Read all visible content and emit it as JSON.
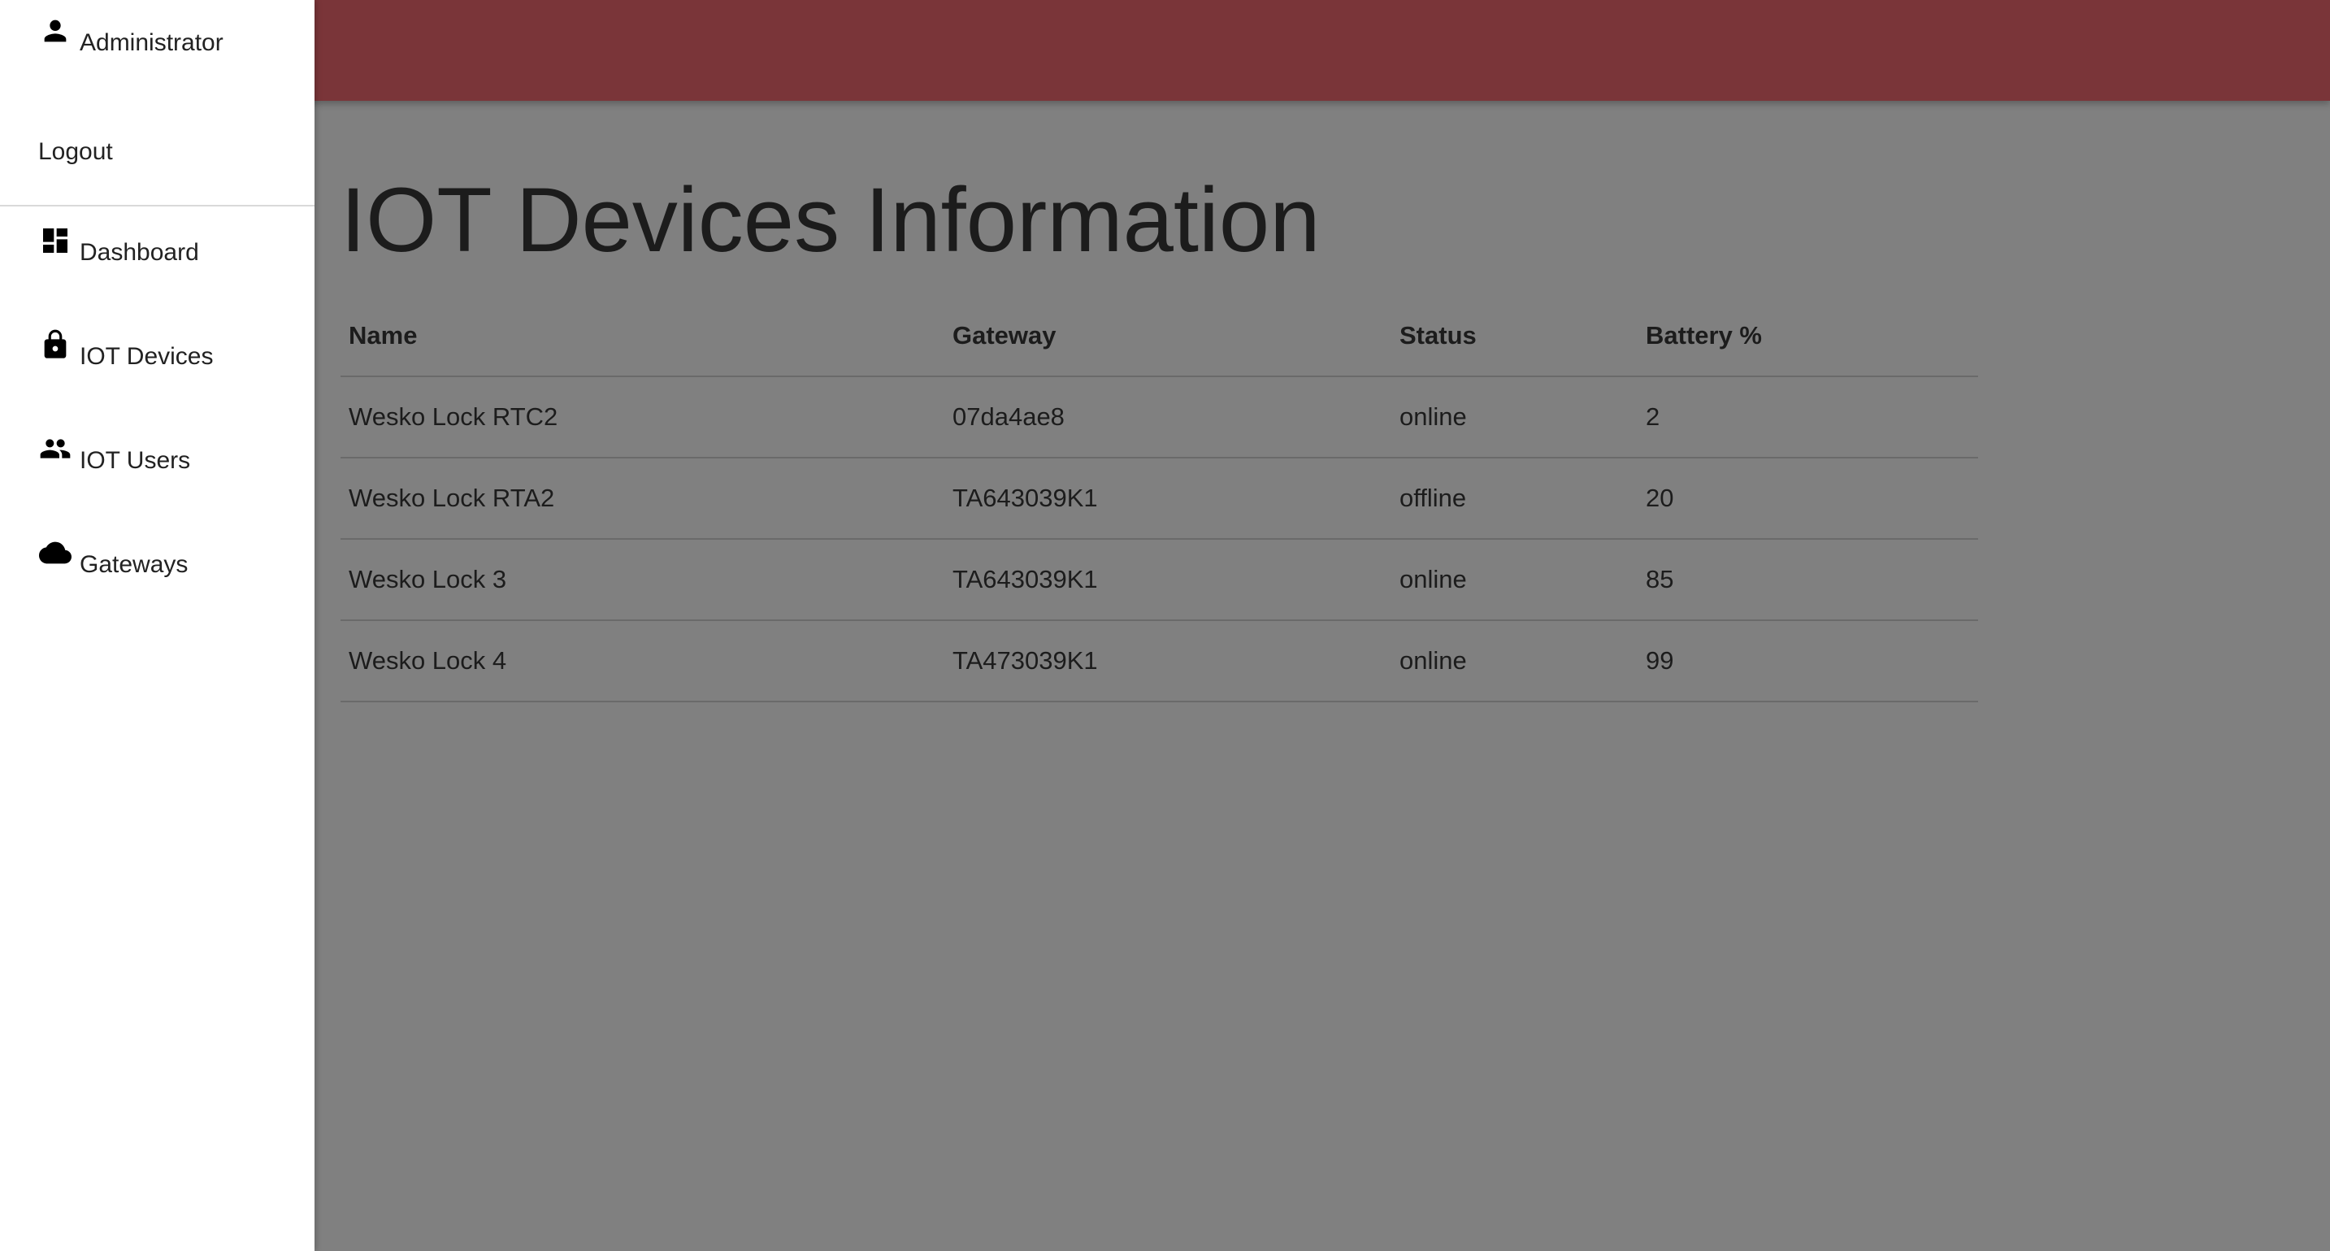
{
  "header": {
    "color": "#7a3539"
  },
  "sidebar": {
    "user": {
      "label": "Administrator",
      "icon": "person-icon"
    },
    "logout_label": "Logout",
    "items": [
      {
        "label": "Dashboard",
        "icon": "dashboard-icon"
      },
      {
        "label": "IOT Devices",
        "icon": "lock-icon"
      },
      {
        "label": "IOT Users",
        "icon": "people-icon"
      },
      {
        "label": "Gateways",
        "icon": "cloud-icon"
      }
    ]
  },
  "main": {
    "title": "IOT Devices Information",
    "table": {
      "columns": [
        "Name",
        "Gateway",
        "Status",
        "Battery %"
      ],
      "rows": [
        [
          "Wesko Lock RTC2",
          "07da4ae8",
          "online",
          "2"
        ],
        [
          "Wesko Lock RTA2",
          "TA643039K1",
          "offline",
          "20"
        ],
        [
          "Wesko Lock 3",
          "TA643039K1",
          "online",
          "85"
        ],
        [
          "Wesko Lock 4",
          "TA473039K1",
          "online",
          "99"
        ]
      ]
    }
  }
}
